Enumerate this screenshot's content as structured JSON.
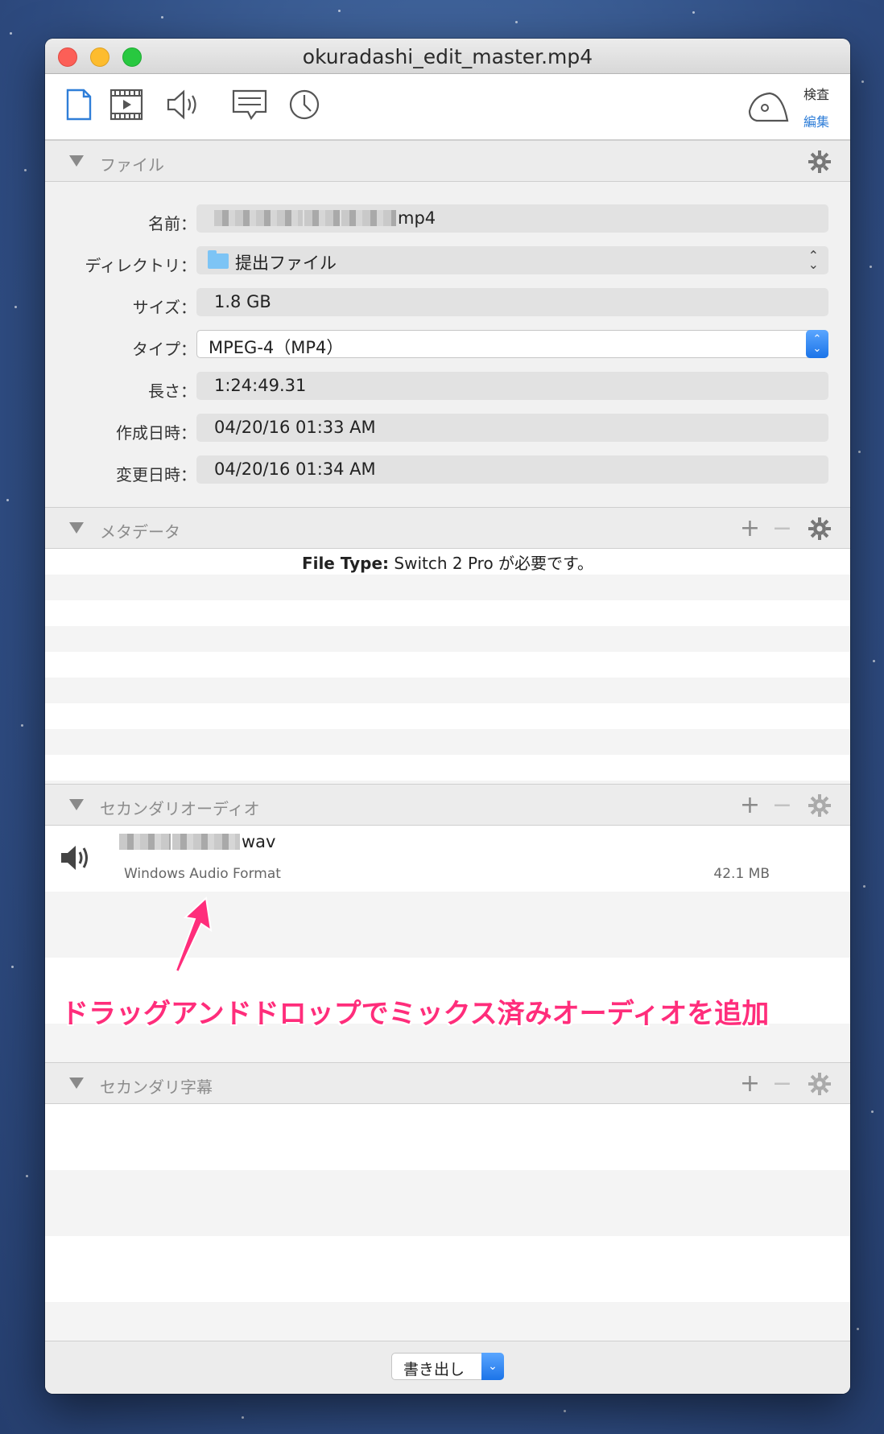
{
  "window": {
    "title": "okuradashi_edit_master.mp4"
  },
  "toolbar": {
    "icons": [
      "document-icon",
      "film-icon",
      "speaker-icon",
      "subtitle-icon",
      "clock-icon"
    ],
    "inspect_label": "検査",
    "edit_label": "編集"
  },
  "file_section": {
    "header": "ファイル",
    "fields": {
      "name_label": "名前：",
      "name_value": "mp4",
      "directory_label": "ディレクトリ：",
      "directory_value": "提出ファイル",
      "size_label": "サイズ：",
      "size_value": "1.8 GB",
      "type_label": "タイプ：",
      "type_value": "MPEG-4（MP4）",
      "length_label": "長さ：",
      "length_value": "1:24:49.31",
      "created_label": "作成日時：",
      "created_value": "04/20/16 01:33 AM",
      "modified_label": "変更日時：",
      "modified_value": "04/20/16 01:34 AM"
    }
  },
  "metadata_section": {
    "header": "メタデータ",
    "file_type_label": "File Type:",
    "file_type_value": "Switch 2 Pro が必要です。"
  },
  "audio_section": {
    "header": "セカンダリオーディオ",
    "item": {
      "name": "wav",
      "format": "Windows Audio Format",
      "size": "42.1 MB"
    },
    "annotation": "ドラッグアンドドロップでミックス済みオーディオを追加"
  },
  "subtitle_section": {
    "header": "セカンダリ字幕"
  },
  "footer": {
    "export_label": "書き出し"
  },
  "colors": {
    "accent": "#2f7ed8",
    "annotation": "#ff2d7b"
  }
}
